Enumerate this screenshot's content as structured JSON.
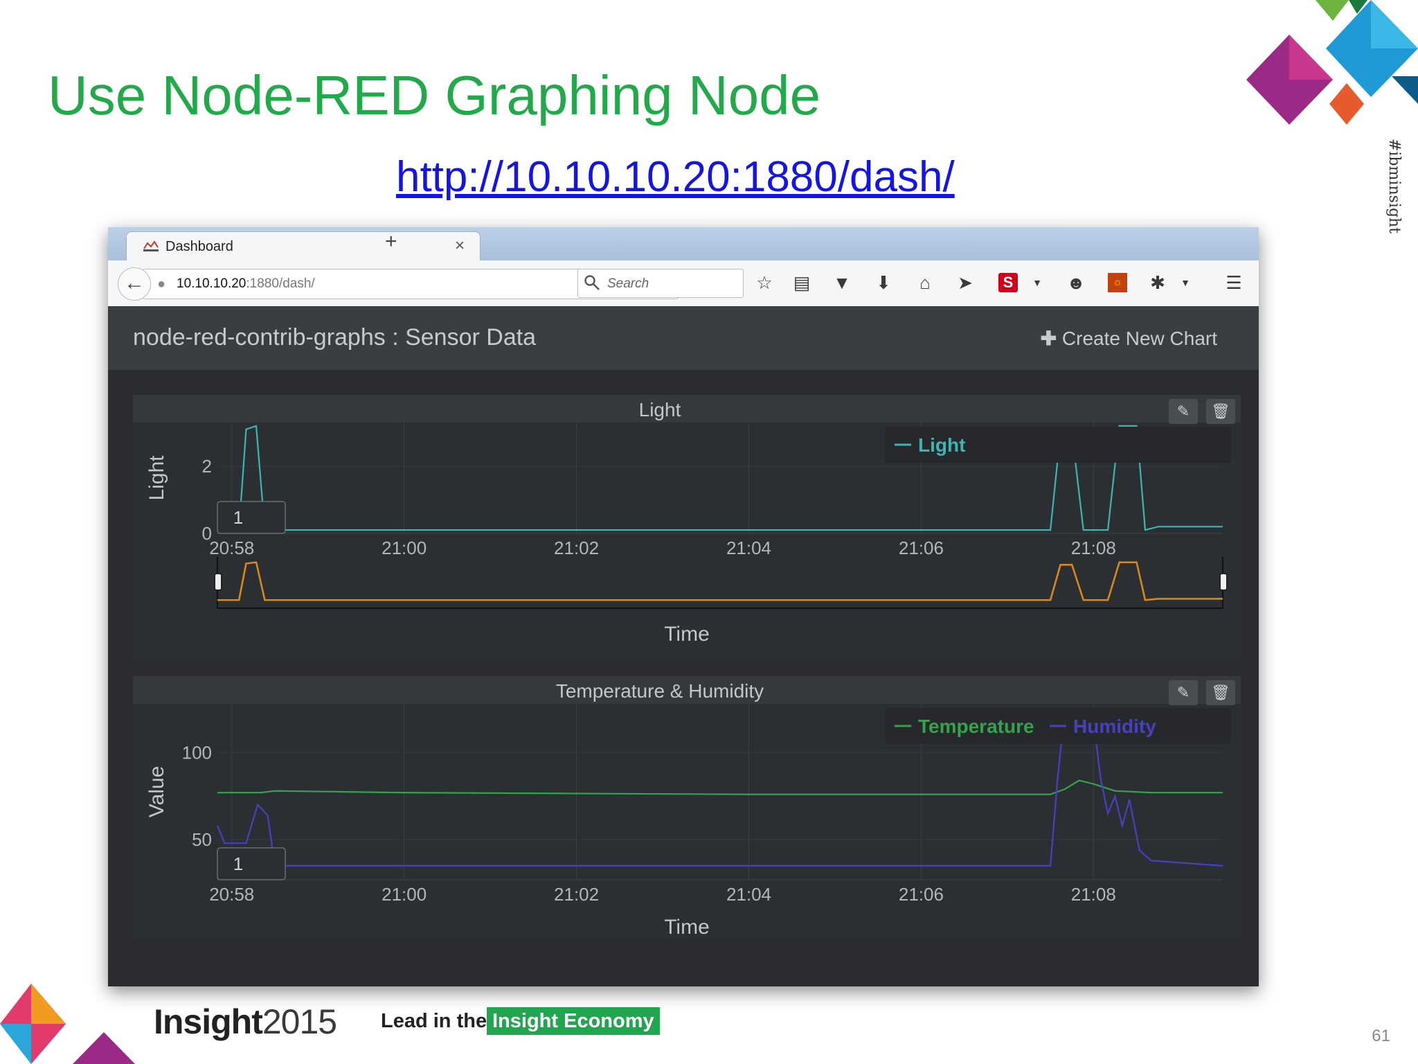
{
  "slide": {
    "title": "Use Node-RED Graphing Node",
    "link": "http://10.10.10.20:1880/dash/",
    "hashtag": "#ibminsight",
    "footer_brand": "Insight",
    "footer_year": "2015",
    "footer_tagline": "Lead in the",
    "footer_tagline_badge": "Insight Economy",
    "page_number": "61"
  },
  "browser": {
    "tab_label": "Dashboard",
    "url_host": "10.10.10.20",
    "url_path": ":1880/dash/",
    "search_placeholder": "Search"
  },
  "app": {
    "title": "node-red-contrib-graphs : Sensor Data",
    "create_button": "Create New Chart"
  },
  "colors": {
    "light": "#3fb5b0",
    "overview": "#d88a16",
    "temperature": "#34a34a",
    "humidity": "#4741c2",
    "brand_green": "#21a650"
  },
  "chart_data": [
    {
      "type": "line",
      "title": "Light",
      "ylabel": "Light",
      "xlabel": "Time",
      "x_ticks": [
        "20:58",
        "21:00",
        "21:02",
        "21:04",
        "21:06",
        "21:08"
      ],
      "y_ticks": [
        "0",
        "2"
      ],
      "ylim": [
        0,
        3.3
      ],
      "zoom_label": "1",
      "legend_position": "top-right",
      "series": [
        {
          "name": "Light",
          "points": [
            [
              "20:57:50",
              0.1
            ],
            [
              "20:58:05",
              0.1
            ],
            [
              "20:58:10",
              3.1
            ],
            [
              "20:58:17",
              3.2
            ],
            [
              "20:58:23",
              0.1
            ],
            [
              "21:07:30",
              0.1
            ],
            [
              "21:07:37",
              3.0
            ],
            [
              "21:07:45",
              3.0
            ],
            [
              "21:07:53",
              0.1
            ],
            [
              "21:08:10",
              0.1
            ],
            [
              "21:08:18",
              3.2
            ],
            [
              "21:08:30",
              3.2
            ],
            [
              "21:08:36",
              0.1
            ],
            [
              "21:08:45",
              0.2
            ],
            [
              "21:09:30",
              0.2
            ]
          ]
        }
      ]
    },
    {
      "type": "line",
      "title": "Temperature & Humidity",
      "ylabel": "Value",
      "xlabel": "Time",
      "x_ticks": [
        "20:58",
        "21:00",
        "21:02",
        "21:04",
        "21:06",
        "21:08"
      ],
      "y_ticks": [
        "50",
        "100"
      ],
      "ylim": [
        27,
        128
      ],
      "zoom_label": "1",
      "legend_position": "top-right",
      "series": [
        {
          "name": "Temperature",
          "points": [
            [
              "20:57:50",
              77
            ],
            [
              "20:58:20",
              77
            ],
            [
              "20:58:30",
              78
            ],
            [
              "21:00:00",
              77
            ],
            [
              "21:04:00",
              76
            ],
            [
              "21:07:30",
              76
            ],
            [
              "21:07:40",
              79
            ],
            [
              "21:07:50",
              84
            ],
            [
              "21:08:00",
              82
            ],
            [
              "21:08:15",
              78
            ],
            [
              "21:08:40",
              77
            ],
            [
              "21:09:30",
              77
            ]
          ]
        },
        {
          "name": "Humidity",
          "points": [
            [
              "20:57:50",
              58
            ],
            [
              "20:57:55",
              48
            ],
            [
              "20:58:10",
              48
            ],
            [
              "20:58:18",
              70
            ],
            [
              "20:58:25",
              64
            ],
            [
              "20:58:30",
              35
            ],
            [
              "21:00:00",
              35
            ],
            [
              "21:02:00",
              35
            ],
            [
              "21:04:00",
              35
            ],
            [
              "21:06:00",
              35
            ],
            [
              "21:07:30",
              35
            ],
            [
              "21:07:35",
              85
            ],
            [
              "21:07:40",
              125
            ],
            [
              "21:07:50",
              125
            ],
            [
              "21:08:00",
              118
            ],
            [
              "21:08:05",
              85
            ],
            [
              "21:08:10",
              65
            ],
            [
              "21:08:15",
              75
            ],
            [
              "21:08:20",
              58
            ],
            [
              "21:08:25",
              73
            ],
            [
              "21:08:32",
              44
            ],
            [
              "21:08:40",
              38
            ],
            [
              "21:09:30",
              35
            ]
          ]
        }
      ]
    }
  ]
}
